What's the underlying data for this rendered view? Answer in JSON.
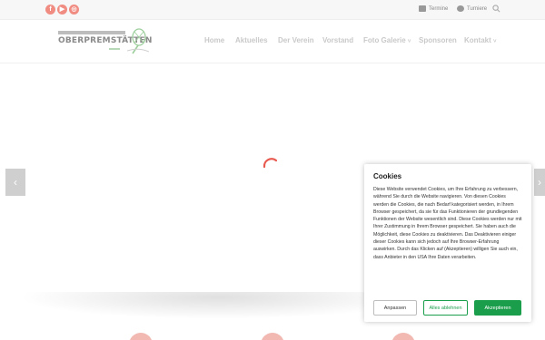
{
  "topbar": {
    "social": [
      {
        "name": "facebook-icon",
        "glyph": "f"
      },
      {
        "name": "youtube-icon",
        "glyph": "▶"
      },
      {
        "name": "instagram-icon",
        "glyph": "◎"
      }
    ],
    "links": [
      "Termine",
      "Turniere"
    ]
  },
  "header": {
    "logo_text": "OBERPREMSTÄTTEN",
    "nav": [
      "Home",
      "Aktuelles",
      "Der Verein",
      "Vorstand",
      "Foto Galerie",
      "Sponsoren",
      "Kontakt"
    ],
    "dropdown_mark": "˅"
  },
  "slider": {
    "prev_glyph": "‹",
    "next_glyph": "›"
  },
  "cookie": {
    "title": "Cookies",
    "text": "Diese Website verwendet Cookies, um Ihre Erfahrung zu verbessern, während Sie durch die Website navigieren. Von diesen Cookies werden die Cookies, die nach Bedarf kategorisiert werden, in Ihrem Browser gespeichert, da sie für das Funktionieren der grundlegenden Funktionen der Website wesentlich sind. Diese Cookies werden nur mit Ihrer Zustimmung in Ihrem Browser gespeichert. Sie haben auch die Möglichkeit, diese Cookies zu deaktivieren. Das Deaktivieren einiger dieser Cookies kann sich jedoch auf Ihre Browser-Erfahrung auswirken. Durch das Klicken auf (Akzeptieren) willigen Sie auch ein, dass Anbieter in den USA Ihre Daten verarbeiten.",
    "buttons": {
      "customize": "Anpassen",
      "reject": "Alles ablehnen",
      "accept": "Akzeptieren"
    }
  },
  "colors": {
    "accent": "#f08c82",
    "green": "#1b9e4b",
    "nav": "#c9c9c9"
  }
}
